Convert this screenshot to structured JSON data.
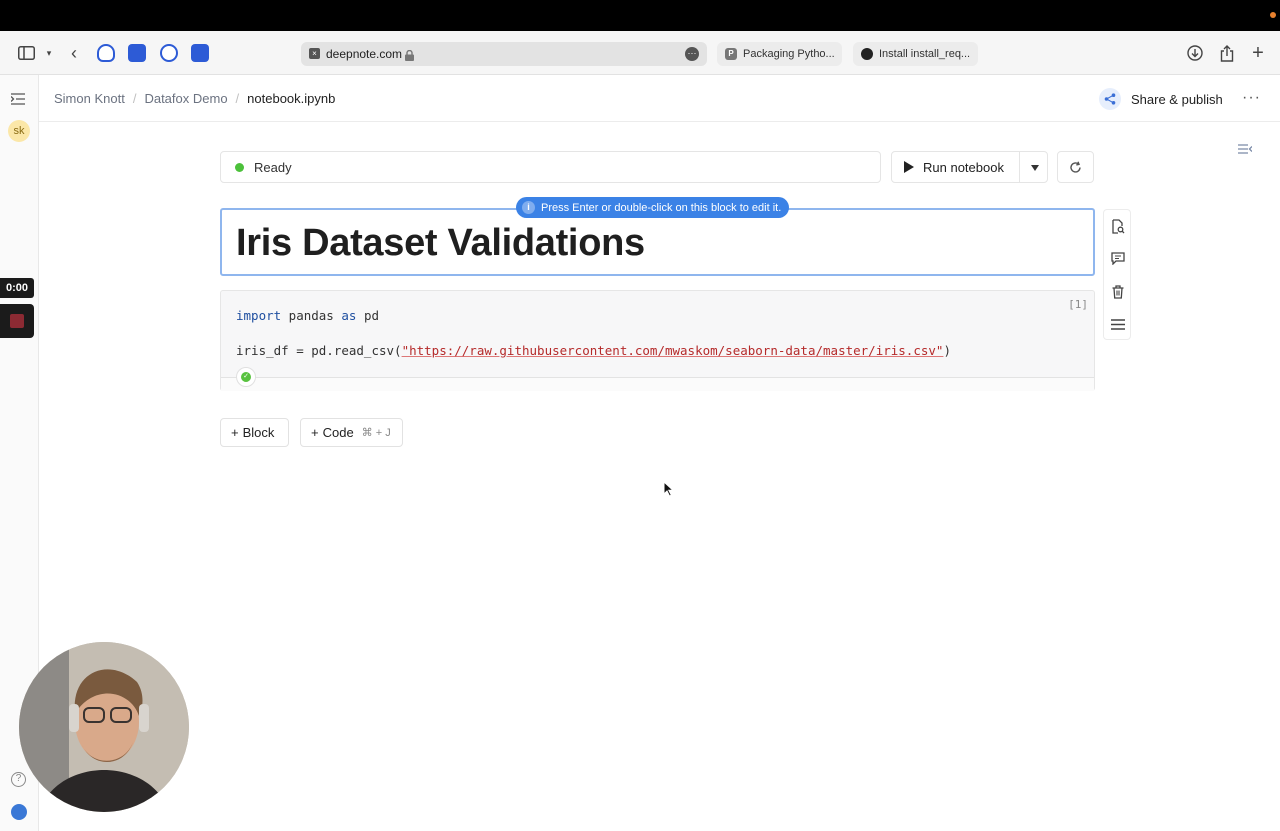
{
  "browser": {
    "url": "deepnote.com",
    "tabs": [
      {
        "label": "Packaging Pytho...",
        "favicon": "P"
      },
      {
        "label": "Install install_req...",
        "favicon": "github"
      }
    ]
  },
  "rail": {
    "avatar_initials": "sk",
    "help_glyph": "?"
  },
  "recorder": {
    "time": "0:00"
  },
  "header": {
    "breadcrumb": [
      "Simon Knott",
      "Datafox Demo",
      "notebook.ipynb"
    ],
    "breadcrumb_separator": "/",
    "share_label": "Share & publish"
  },
  "toolbar": {
    "status": "Ready",
    "status_color": "#4cc13b",
    "run_label": "Run notebook"
  },
  "blocks": {
    "hint": "Press Enter or double-click on this block to edit it.",
    "heading": "Iris Dataset Validations",
    "code": {
      "execution_count": "[1]",
      "line1_kw1": "import",
      "line1_mid": " pandas ",
      "line1_kw2": "as",
      "line1_end": " pd",
      "line2_start": "iris_df = pd.read_csv(",
      "line2_string": "\"https://raw.githubusercontent.com/mwaskom/seaborn-data/master/iris.csv\"",
      "line2_end": ")"
    }
  },
  "add": {
    "block_label": "Block",
    "code_label": "Code",
    "code_shortcut": "⌘ + J"
  },
  "colors": {
    "accent": "#3b82e6",
    "heading_border": "#8fb6ee",
    "keyword": "#1f4fa0",
    "string": "#b52a2a"
  }
}
